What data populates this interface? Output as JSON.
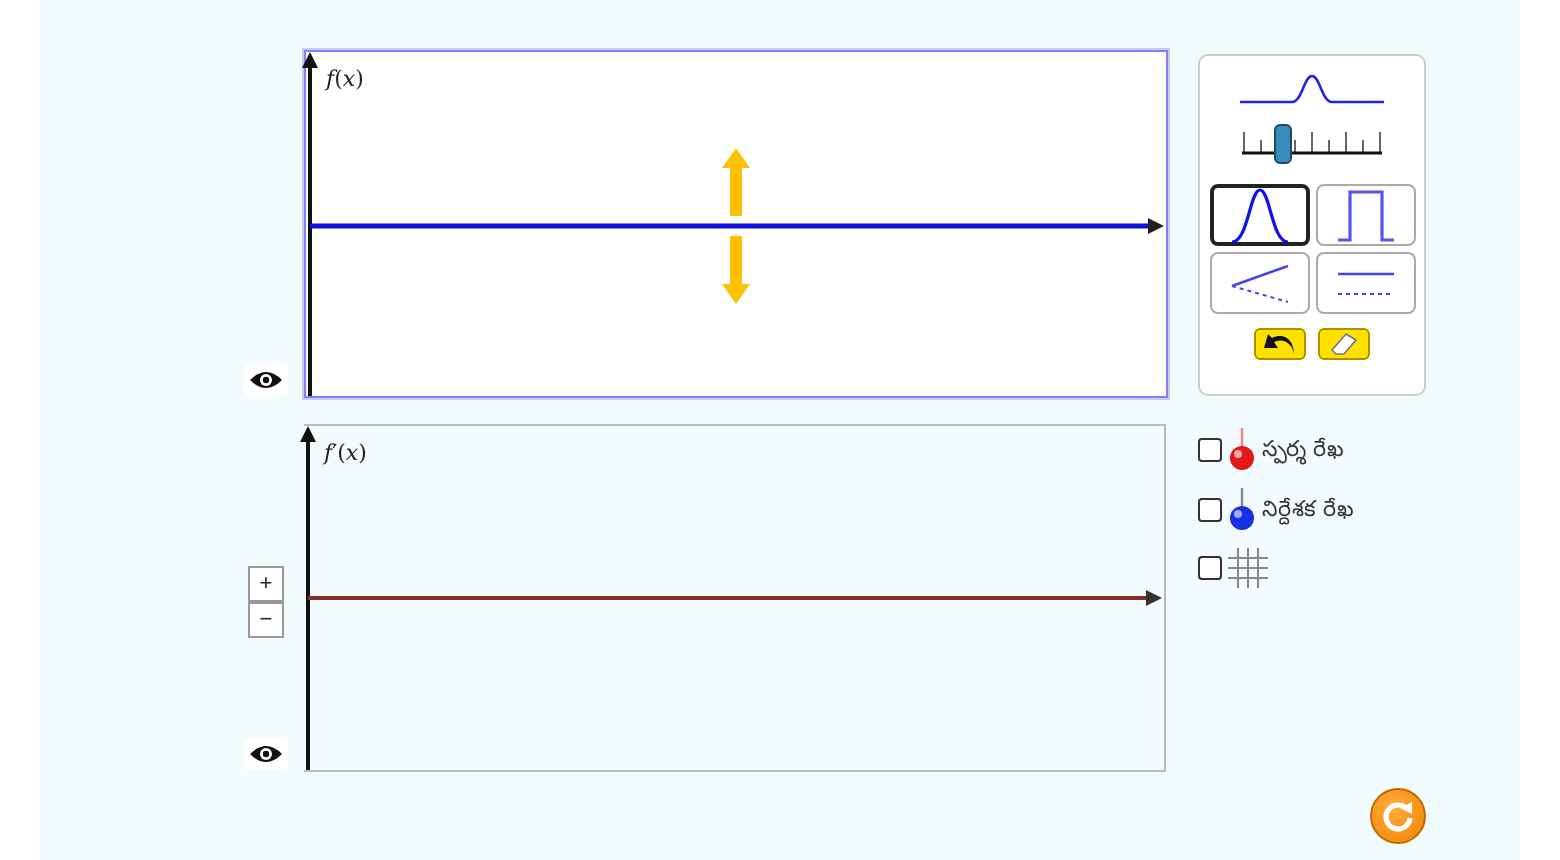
{
  "graphs": [
    {
      "kind": "function",
      "label": "*f*(*x*)"
    },
    {
      "kind": "derivative",
      "label": "*f*′(*x*)"
    }
  ],
  "zoom_buttons": [
    "+",
    "−"
  ],
  "shape_panel": {
    "width_slider": {
      "level": 0.25
    },
    "shapes": [
      {
        "kind": "hump",
        "selected": true
      },
      {
        "kind": "pedestal",
        "selected": false
      },
      {
        "kind": "slope",
        "selected": false
      },
      {
        "kind": "flat",
        "selected": false
      }
    ]
  },
  "options": [
    {
      "kind": "tangent",
      "label": "స్పర్శ రేఖ",
      "checked": false
    },
    {
      "kind": "reference",
      "label": "నిర్దేశక రేఖ",
      "checked": false
    },
    {
      "kind": "grid",
      "checked": false
    }
  ]
}
